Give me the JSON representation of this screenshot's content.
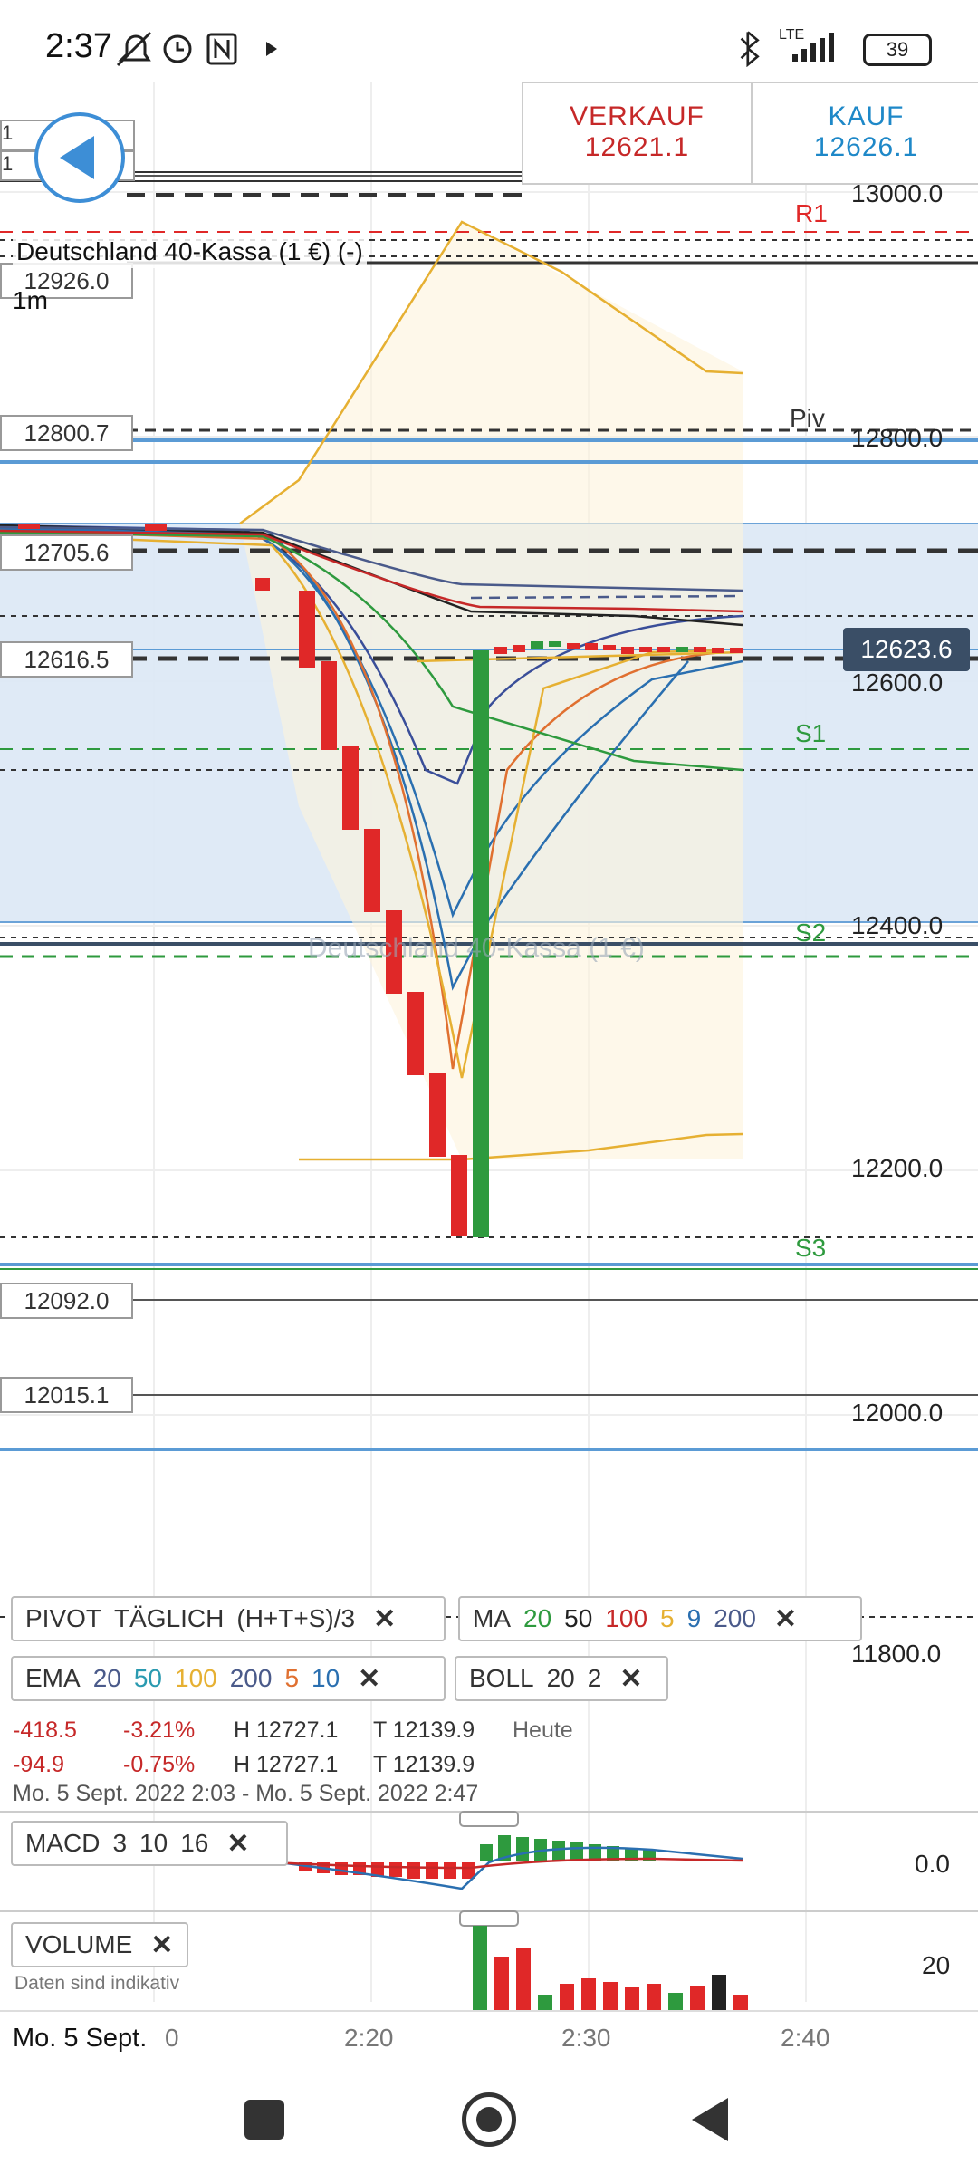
{
  "status_bar": {
    "time": "2:37",
    "battery": "39",
    "network": "LTE"
  },
  "trade": {
    "sell_label": "VERKAUF",
    "sell_price": "12621.1",
    "buy_label": "KAUF",
    "buy_price": "12626.1"
  },
  "instrument": {
    "name": "Deutschland 40-Kassa (1 €) (-)",
    "timeframe": "1m",
    "watermark": "Deutschland 40-Kassa (1 €)"
  },
  "price_boxes": [
    {
      "label": "12926.0"
    },
    {
      "label": "12800.7"
    },
    {
      "label": "12705.6"
    },
    {
      "label": "12616.5"
    },
    {
      "label": "12092.0"
    },
    {
      "label": "12015.1"
    }
  ],
  "axis_labels": [
    "13000.0",
    "12800.0",
    "12600.0",
    "12400.0",
    "12200.0",
    "12000.0",
    "11800.0"
  ],
  "sr_labels": {
    "r1": "R1",
    "piv": "Piv",
    "s1": "S1",
    "s2": "S2",
    "s3": "S3"
  },
  "current_price": "12623.6",
  "colors": {
    "red": "#e02828",
    "green": "#2e9a3e",
    "blue": "#3d8ed6",
    "band": "#dce8f5",
    "gold": "#e6b032"
  },
  "indicators": {
    "pivot": {
      "name": "PIVOT",
      "period": "TÄGLICH",
      "formula": "(H+T+S)/3"
    },
    "ma": {
      "name": "MA",
      "values": [
        "20",
        "50",
        "100",
        "5",
        "9",
        "200"
      ]
    },
    "ema": {
      "name": "EMA",
      "values": [
        "20",
        "50",
        "100",
        "200",
        "5",
        "10"
      ]
    },
    "boll": {
      "name": "BOLL",
      "values": [
        "20",
        "2"
      ]
    },
    "macd": {
      "name": "MACD",
      "values": [
        "3",
        "10",
        "16"
      ]
    },
    "volume": {
      "name": "VOLUME"
    }
  },
  "stats": {
    "row1": {
      "change": "-418.5",
      "pct": "-3.21%",
      "high": "H 12727.1",
      "low": "T 12139.9",
      "period": "Heute"
    },
    "row2": {
      "change": "-94.9",
      "pct": "-0.75%",
      "high": "H 12727.1",
      "low": "T 12139.9"
    },
    "range": "Mo. 5 Sept. 2022 2:03 - Mo. 5 Sept. 2022 2:47"
  },
  "macd_axis": "0.0",
  "volume_axis": "20",
  "disclaimer": "Daten sind indikativ",
  "time_axis": {
    "date": "Mo. 5 Sept.",
    "zero": "0",
    "ticks": [
      "2:20",
      "2:30",
      "2:40"
    ]
  },
  "close_icon": "✕"
}
